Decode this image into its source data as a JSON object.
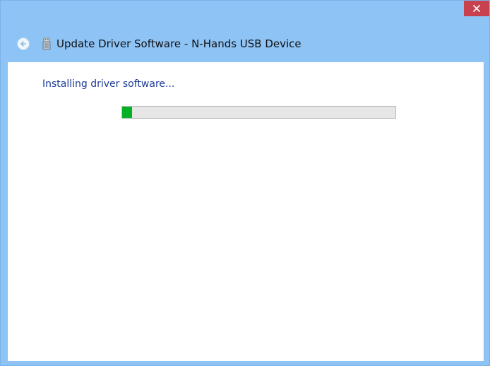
{
  "window": {
    "title": "Update Driver Software - N-Hands USB Device"
  },
  "content": {
    "main_instruction": "Installing driver software...",
    "progress_fraction": 0.035
  },
  "icons": {
    "close": "close-icon",
    "back": "back-arrow-icon",
    "app": "usb-device-icon"
  },
  "colors": {
    "titlebar": "#8ec3f5",
    "close_button": "#c7424e",
    "instruction_text": "#1e3c99",
    "progress_fill": "#06b025"
  }
}
